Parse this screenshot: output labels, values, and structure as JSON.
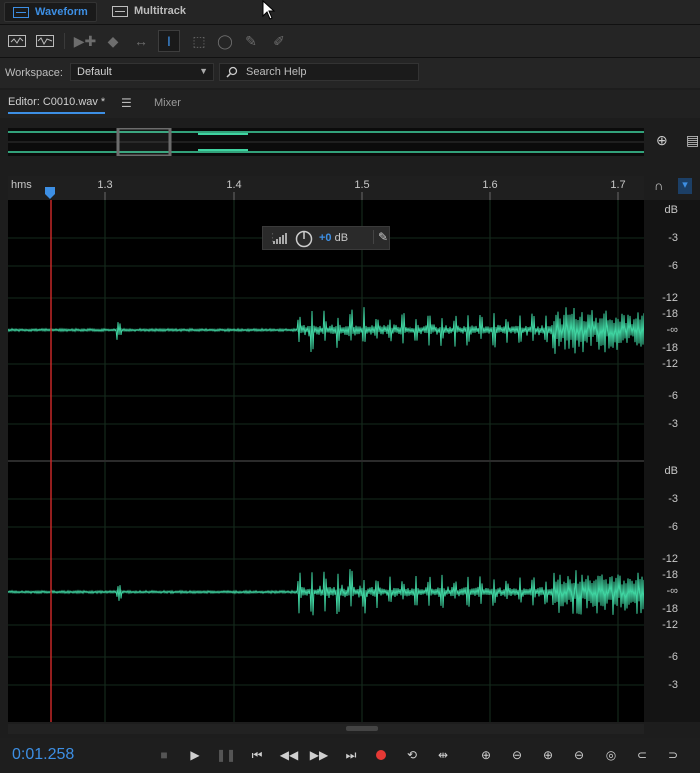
{
  "app": {
    "view_tabs": {
      "waveform": "Waveform",
      "multitrack": "Multitrack"
    },
    "workspace": {
      "label": "Workspace:",
      "value": "Default"
    },
    "search": {
      "placeholder": "Search Help"
    }
  },
  "editor": {
    "tab_label": "Editor: C0010.wav *",
    "mixer_label": "Mixer"
  },
  "ruler": {
    "unit": "hms",
    "ticks": [
      "1.3",
      "1.4",
      "1.5",
      "1.6",
      "1.7"
    ]
  },
  "hud": {
    "value_prefix": "+0",
    "value_unit": " dB"
  },
  "db_scale": {
    "channel_labels": [
      "dB",
      "-3",
      "-6",
      "-12",
      "-18",
      "-∞",
      "-18",
      "-12",
      "-6",
      "-3"
    ]
  },
  "transport": {
    "time": "0:01.258"
  },
  "colors": {
    "accent": "#3d8fe4",
    "waveform": "#3fd3a0",
    "playhead": "#c62828",
    "record": "#e53935"
  }
}
